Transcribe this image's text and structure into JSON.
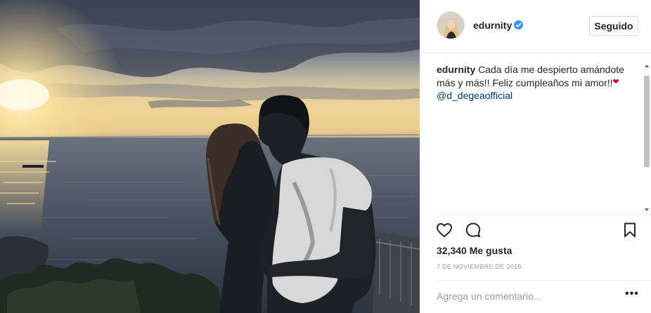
{
  "post": {
    "author": {
      "username": "edurnity",
      "verified": true,
      "verified_icon": "verified-badge-icon",
      "follow_label": "Seguido"
    },
    "caption": {
      "username": "edurnity",
      "text": "Cada día me despierto amándote más y más!! Feliz cumpleaños mi amor!!",
      "emoji": "❤",
      "mention": "@d_degeaofficial"
    },
    "actions": {
      "like_icon": "heart-icon",
      "comment_icon": "comment-bubble-icon",
      "save_icon": "bookmark-icon"
    },
    "likes": "32,340 Me gusta",
    "date": "7 DE NOVIEMBRE DE 2016",
    "comment_placeholder": "Agrega un comentario...",
    "more_options": "•••"
  },
  "colors": {
    "link": "#003569",
    "verified": "#3897f0",
    "muted": "#999999",
    "divider": "#efefef"
  }
}
